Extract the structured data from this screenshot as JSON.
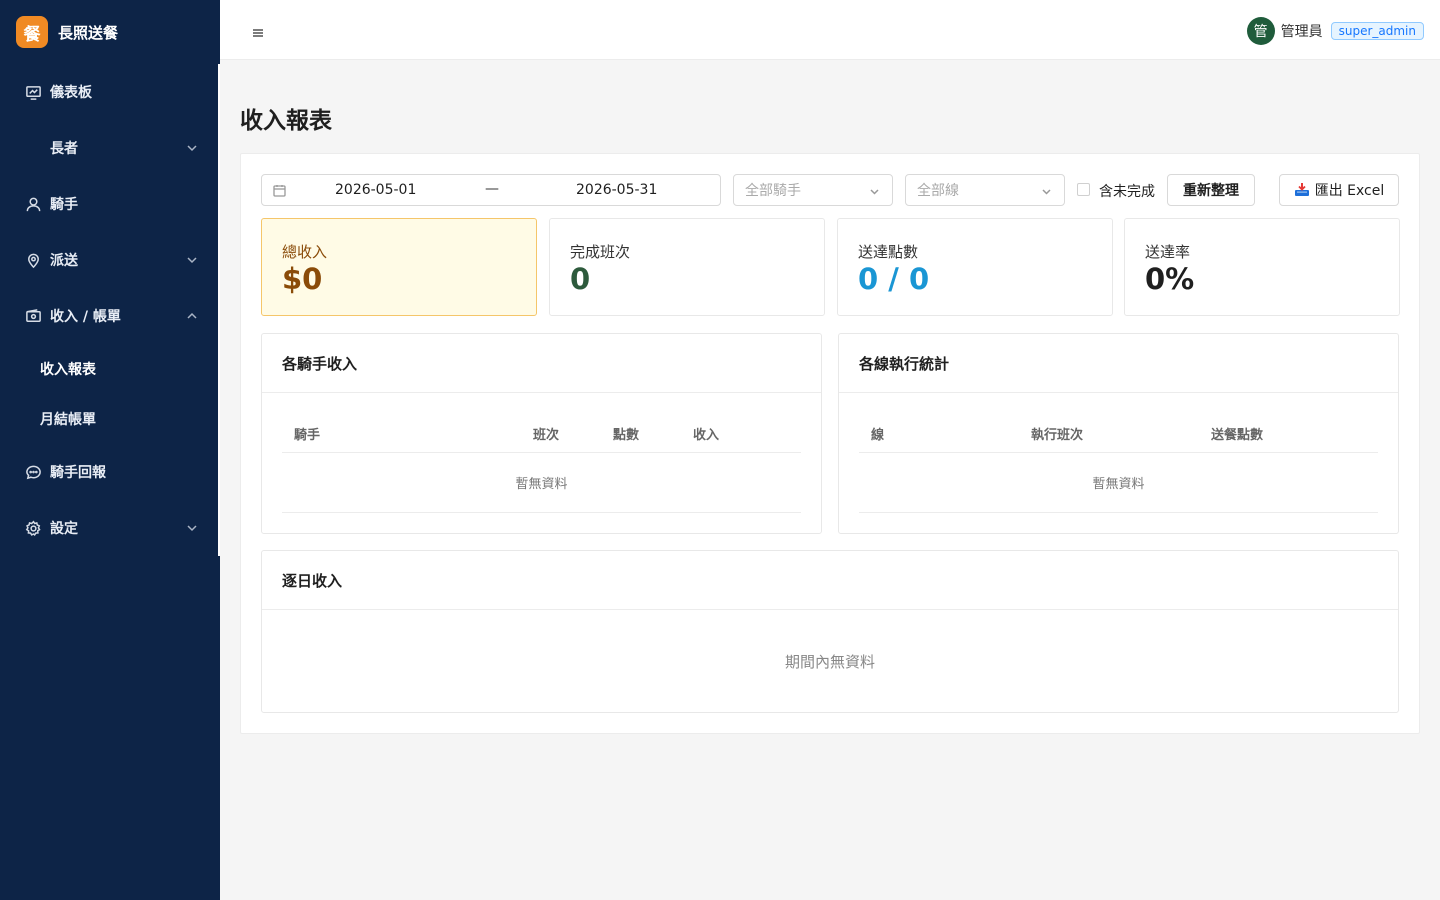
{
  "brand": {
    "logo_char": "餐",
    "title": "長照送餐"
  },
  "sidebar": {
    "items": [
      {
        "label": "儀表板"
      },
      {
        "label": "長者"
      },
      {
        "label": "騎手"
      },
      {
        "label": "派送"
      },
      {
        "label": "收入 / 帳單"
      },
      {
        "label": "騎手回報"
      },
      {
        "label": "設定"
      }
    ],
    "sub_items": [
      {
        "label": "收入報表"
      },
      {
        "label": "月結帳單"
      }
    ]
  },
  "header": {
    "avatar_char": "管",
    "user_name": "管理員",
    "role": "super_admin"
  },
  "page": {
    "title": "收入報表"
  },
  "filters": {
    "date_start": "2026-05-01",
    "date_sep": "—",
    "date_end": "2026-05-31",
    "rider_placeholder": "全部騎手",
    "line_placeholder": "全部線",
    "include_incomplete_label": "含未完成",
    "refresh_label": "重新整理",
    "export_label": "匯出 Excel"
  },
  "stats": [
    {
      "label": "總收入",
      "value": "$0",
      "color": "#8a4b08"
    },
    {
      "label": "完成班次",
      "value": "0",
      "color": "#2d5a3c"
    },
    {
      "label": "送達點數",
      "value": "0 / 0",
      "color": "#1a96d4"
    },
    {
      "label": "送達率",
      "value": "0%",
      "color": "#1f1f1f"
    }
  ],
  "rider_table": {
    "title": "各騎手收入",
    "columns": [
      "騎手",
      "班次",
      "點數",
      "收入"
    ],
    "empty_text": "暫無資料"
  },
  "line_table": {
    "title": "各線執行統計",
    "columns": [
      "線",
      "執行班次",
      "送餐點數"
    ],
    "empty_text": "暫無資料"
  },
  "daily": {
    "title": "逐日收入",
    "empty_text": "期間內無資料"
  },
  "colors": {
    "sidebar_bg": "#0d2447",
    "brand_orange": "#f08a24",
    "avatar_green": "#1f5c3b",
    "role_blue": "#1677ff"
  }
}
